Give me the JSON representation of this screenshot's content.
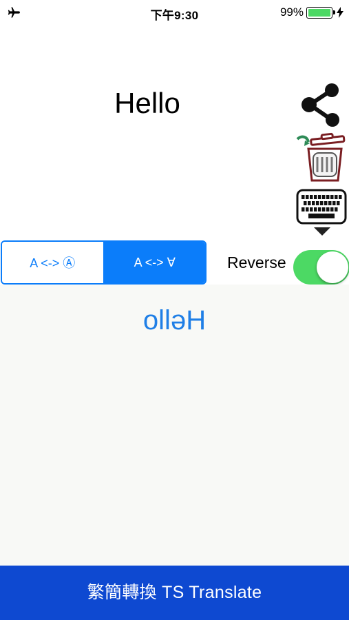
{
  "status_bar": {
    "time": "下午9:30",
    "battery_percent": "99%",
    "battery_level": 0.99,
    "icons": [
      "airplane-icon",
      "battery-icon",
      "charging-bolt-icon"
    ]
  },
  "input": {
    "text": "Hello"
  },
  "tools": {
    "share_icon": "share-icon",
    "trash_icon": "trash-icon",
    "keyboard_icon": "keyboard-icon"
  },
  "modes": {
    "options": [
      "A <-> Ⓐ",
      "A <-> ∀"
    ],
    "selected_index": 1
  },
  "reverse": {
    "label": "Reverse",
    "on": true
  },
  "output": {
    "text": "olləH"
  },
  "bottom_bar": {
    "title": "繁簡轉換 TS Translate"
  },
  "colors": {
    "accent_blue": "#0b7dfa",
    "output_text": "#1f7fe6",
    "toggle_on": "#4cd964",
    "bottom_bar": "#0e49d1",
    "output_bg": "#f8f9f6",
    "trash_outline": "#7a1e22",
    "arrow_green": "#2e8b57"
  }
}
